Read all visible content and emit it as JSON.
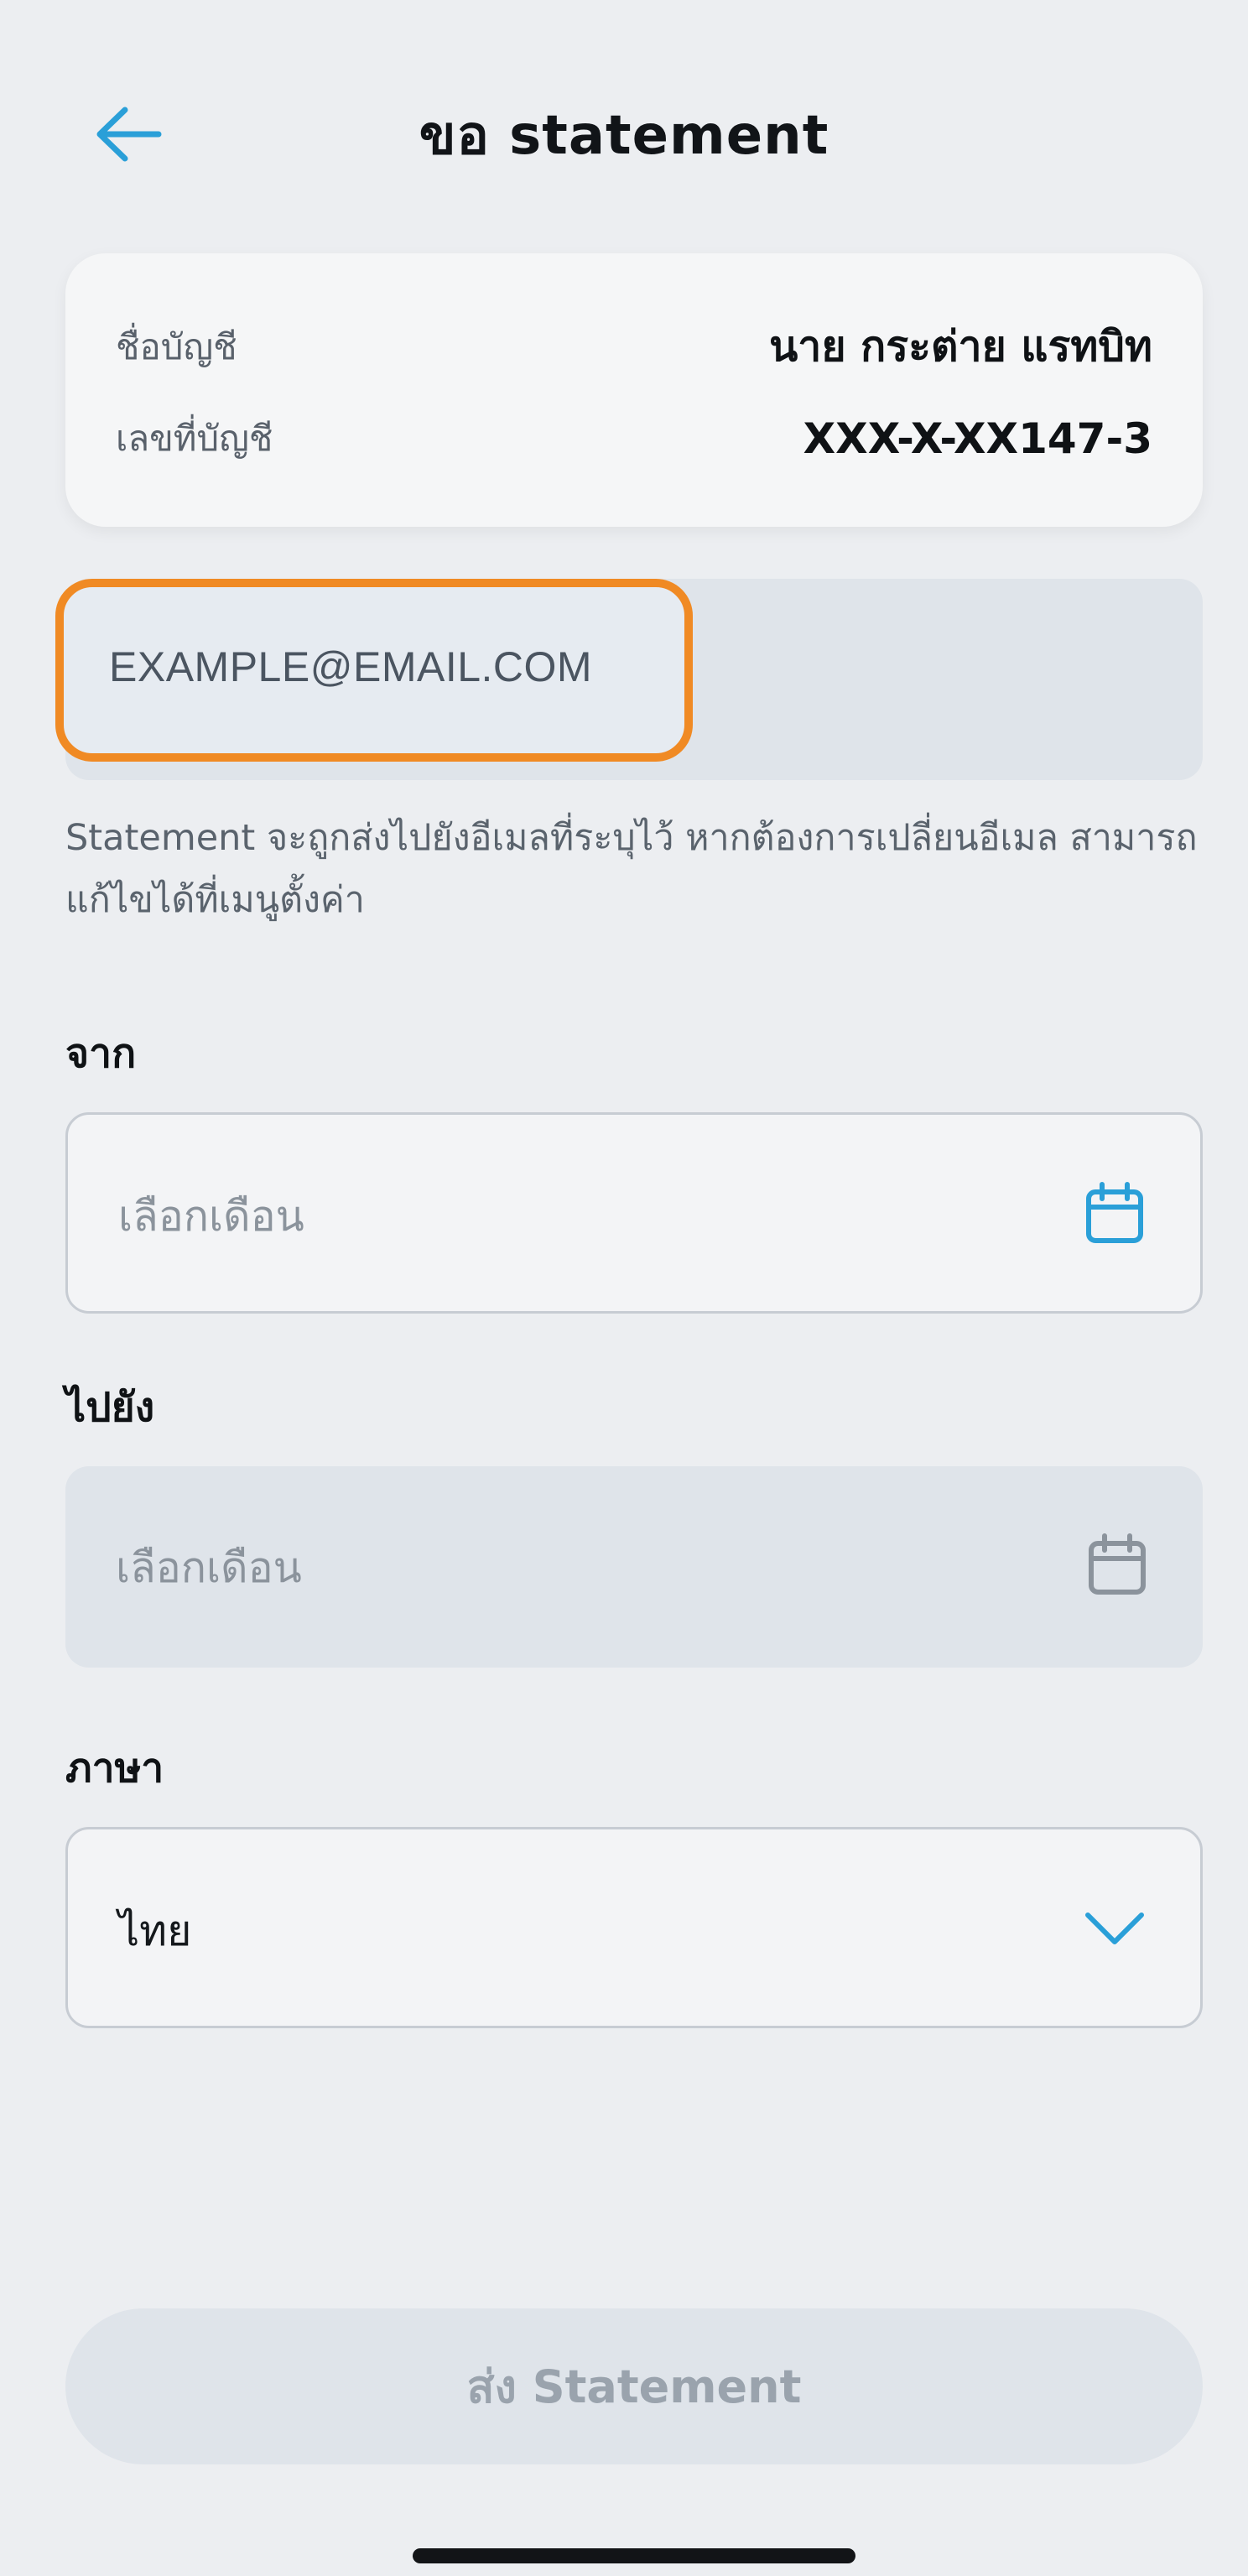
{
  "header": {
    "title": "ขอ statement",
    "back_icon": "arrow-left-icon"
  },
  "account": {
    "name_label": "ชื่อบัญชี",
    "name_value": "นาย กระต่าย แรทบิท",
    "number_label": "เลขที่บัญชี",
    "number_value": "XXX-X-XX147-3"
  },
  "email": {
    "value": "EXAMPLE@EMAIL.COM",
    "highlight_color": "#f08a24"
  },
  "hint": "Statement จะถูกส่งไปยังอีเมลที่ระบุไว้ หากต้องการเปลี่ยนอีเมล สามารถแก้ไขได้ที่เมนูตั้งค่า",
  "from": {
    "label": "จาก",
    "placeholder": "เลือกเดือน",
    "icon": "calendar-icon"
  },
  "to": {
    "label": "ไปยัง",
    "placeholder": "เลือกเดือน",
    "icon": "calendar-icon"
  },
  "language": {
    "label": "ภาษา",
    "selected": "ไทย",
    "icon": "chevron-down-icon"
  },
  "submit": {
    "label": "ส่ง Statement"
  },
  "colors": {
    "accent": "#2a9fd8",
    "background": "#eceef1"
  }
}
